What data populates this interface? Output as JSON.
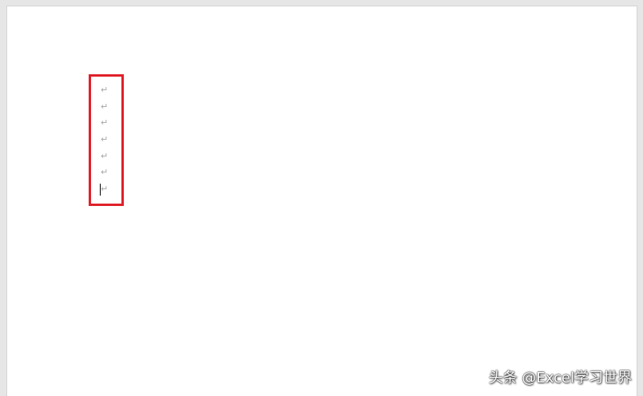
{
  "document": {
    "paragraph_marks": [
      "↵",
      "↵",
      "↵",
      "↵",
      "↵",
      "↵",
      "↵"
    ],
    "highlight_color": "#e0202a",
    "mark_color": "#a6a6a6"
  },
  "watermark": {
    "text": "头条 @Excel学习世界"
  }
}
